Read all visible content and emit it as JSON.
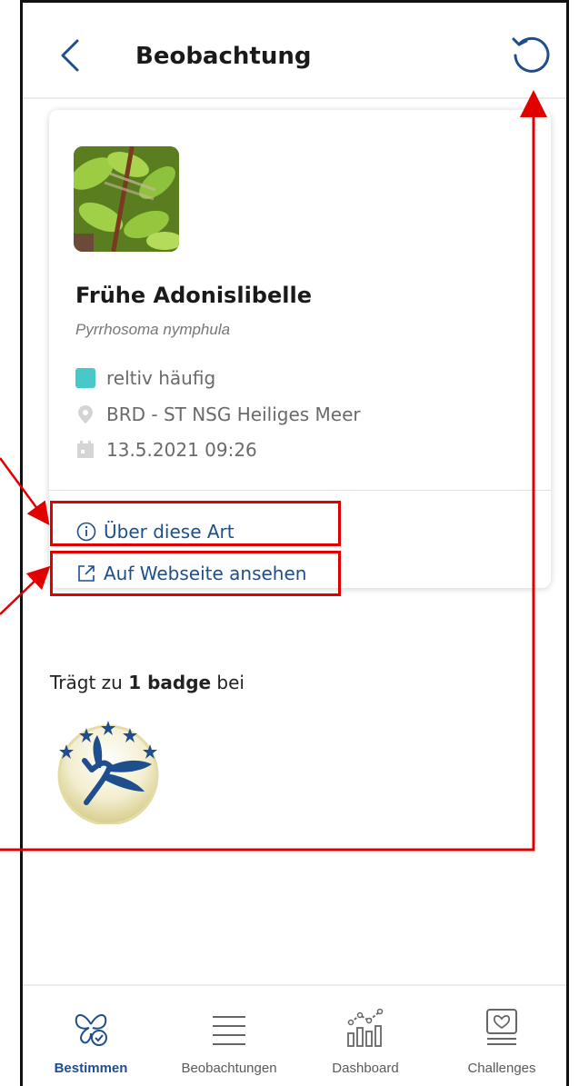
{
  "header": {
    "title": "Beobachtung"
  },
  "observation": {
    "species_name": "Frühe Adonislibelle",
    "latin_name": "Pyrrhosoma nymphula",
    "frequency": "reltiv häufig",
    "frequency_color": "#48c8c8",
    "location": "BRD - ST NSG Heiliges Meer",
    "datetime": "13.5.2021 09:26",
    "links": {
      "about_label": "Über diese Art",
      "website_label": "Auf Webseite ansehen"
    }
  },
  "badges": {
    "prefix": "Trägt zu ",
    "count_label": "1 badge",
    "suffix": " bei"
  },
  "tabbar": {
    "tabs": [
      {
        "label": "Bestimmen",
        "icon": "butterfly-check-icon",
        "active": true
      },
      {
        "label": "Beobachtungen",
        "icon": "list-icon",
        "active": false
      },
      {
        "label": "Dashboard",
        "icon": "chart-icon",
        "active": false
      },
      {
        "label": "Challenges",
        "icon": "heart-card-icon",
        "active": false
      }
    ]
  },
  "colors": {
    "accent": "#1f4e8c",
    "annotation": "#e00000"
  }
}
